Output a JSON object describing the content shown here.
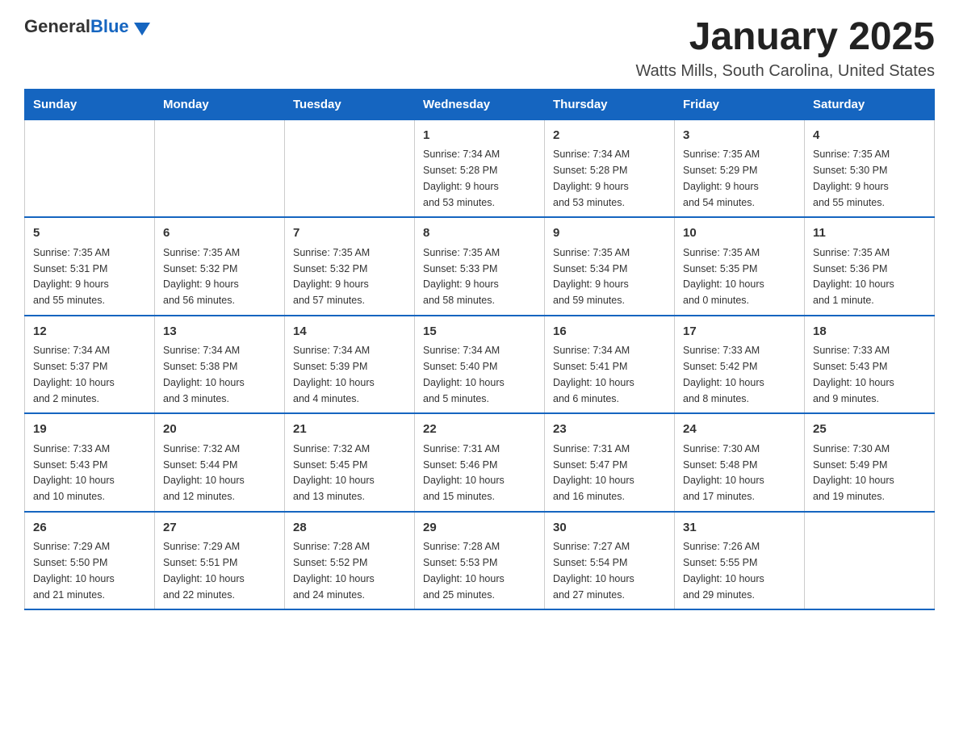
{
  "header": {
    "logo_general": "General",
    "logo_blue": "Blue",
    "month_title": "January 2025",
    "location": "Watts Mills, South Carolina, United States"
  },
  "weekdays": [
    "Sunday",
    "Monday",
    "Tuesday",
    "Wednesday",
    "Thursday",
    "Friday",
    "Saturday"
  ],
  "weeks": [
    [
      {
        "day": "",
        "info": ""
      },
      {
        "day": "",
        "info": ""
      },
      {
        "day": "",
        "info": ""
      },
      {
        "day": "1",
        "info": "Sunrise: 7:34 AM\nSunset: 5:28 PM\nDaylight: 9 hours\nand 53 minutes."
      },
      {
        "day": "2",
        "info": "Sunrise: 7:34 AM\nSunset: 5:28 PM\nDaylight: 9 hours\nand 53 minutes."
      },
      {
        "day": "3",
        "info": "Sunrise: 7:35 AM\nSunset: 5:29 PM\nDaylight: 9 hours\nand 54 minutes."
      },
      {
        "day": "4",
        "info": "Sunrise: 7:35 AM\nSunset: 5:30 PM\nDaylight: 9 hours\nand 55 minutes."
      }
    ],
    [
      {
        "day": "5",
        "info": "Sunrise: 7:35 AM\nSunset: 5:31 PM\nDaylight: 9 hours\nand 55 minutes."
      },
      {
        "day": "6",
        "info": "Sunrise: 7:35 AM\nSunset: 5:32 PM\nDaylight: 9 hours\nand 56 minutes."
      },
      {
        "day": "7",
        "info": "Sunrise: 7:35 AM\nSunset: 5:32 PM\nDaylight: 9 hours\nand 57 minutes."
      },
      {
        "day": "8",
        "info": "Sunrise: 7:35 AM\nSunset: 5:33 PM\nDaylight: 9 hours\nand 58 minutes."
      },
      {
        "day": "9",
        "info": "Sunrise: 7:35 AM\nSunset: 5:34 PM\nDaylight: 9 hours\nand 59 minutes."
      },
      {
        "day": "10",
        "info": "Sunrise: 7:35 AM\nSunset: 5:35 PM\nDaylight: 10 hours\nand 0 minutes."
      },
      {
        "day": "11",
        "info": "Sunrise: 7:35 AM\nSunset: 5:36 PM\nDaylight: 10 hours\nand 1 minute."
      }
    ],
    [
      {
        "day": "12",
        "info": "Sunrise: 7:34 AM\nSunset: 5:37 PM\nDaylight: 10 hours\nand 2 minutes."
      },
      {
        "day": "13",
        "info": "Sunrise: 7:34 AM\nSunset: 5:38 PM\nDaylight: 10 hours\nand 3 minutes."
      },
      {
        "day": "14",
        "info": "Sunrise: 7:34 AM\nSunset: 5:39 PM\nDaylight: 10 hours\nand 4 minutes."
      },
      {
        "day": "15",
        "info": "Sunrise: 7:34 AM\nSunset: 5:40 PM\nDaylight: 10 hours\nand 5 minutes."
      },
      {
        "day": "16",
        "info": "Sunrise: 7:34 AM\nSunset: 5:41 PM\nDaylight: 10 hours\nand 6 minutes."
      },
      {
        "day": "17",
        "info": "Sunrise: 7:33 AM\nSunset: 5:42 PM\nDaylight: 10 hours\nand 8 minutes."
      },
      {
        "day": "18",
        "info": "Sunrise: 7:33 AM\nSunset: 5:43 PM\nDaylight: 10 hours\nand 9 minutes."
      }
    ],
    [
      {
        "day": "19",
        "info": "Sunrise: 7:33 AM\nSunset: 5:43 PM\nDaylight: 10 hours\nand 10 minutes."
      },
      {
        "day": "20",
        "info": "Sunrise: 7:32 AM\nSunset: 5:44 PM\nDaylight: 10 hours\nand 12 minutes."
      },
      {
        "day": "21",
        "info": "Sunrise: 7:32 AM\nSunset: 5:45 PM\nDaylight: 10 hours\nand 13 minutes."
      },
      {
        "day": "22",
        "info": "Sunrise: 7:31 AM\nSunset: 5:46 PM\nDaylight: 10 hours\nand 15 minutes."
      },
      {
        "day": "23",
        "info": "Sunrise: 7:31 AM\nSunset: 5:47 PM\nDaylight: 10 hours\nand 16 minutes."
      },
      {
        "day": "24",
        "info": "Sunrise: 7:30 AM\nSunset: 5:48 PM\nDaylight: 10 hours\nand 17 minutes."
      },
      {
        "day": "25",
        "info": "Sunrise: 7:30 AM\nSunset: 5:49 PM\nDaylight: 10 hours\nand 19 minutes."
      }
    ],
    [
      {
        "day": "26",
        "info": "Sunrise: 7:29 AM\nSunset: 5:50 PM\nDaylight: 10 hours\nand 21 minutes."
      },
      {
        "day": "27",
        "info": "Sunrise: 7:29 AM\nSunset: 5:51 PM\nDaylight: 10 hours\nand 22 minutes."
      },
      {
        "day": "28",
        "info": "Sunrise: 7:28 AM\nSunset: 5:52 PM\nDaylight: 10 hours\nand 24 minutes."
      },
      {
        "day": "29",
        "info": "Sunrise: 7:28 AM\nSunset: 5:53 PM\nDaylight: 10 hours\nand 25 minutes."
      },
      {
        "day": "30",
        "info": "Sunrise: 7:27 AM\nSunset: 5:54 PM\nDaylight: 10 hours\nand 27 minutes."
      },
      {
        "day": "31",
        "info": "Sunrise: 7:26 AM\nSunset: 5:55 PM\nDaylight: 10 hours\nand 29 minutes."
      },
      {
        "day": "",
        "info": ""
      }
    ]
  ]
}
